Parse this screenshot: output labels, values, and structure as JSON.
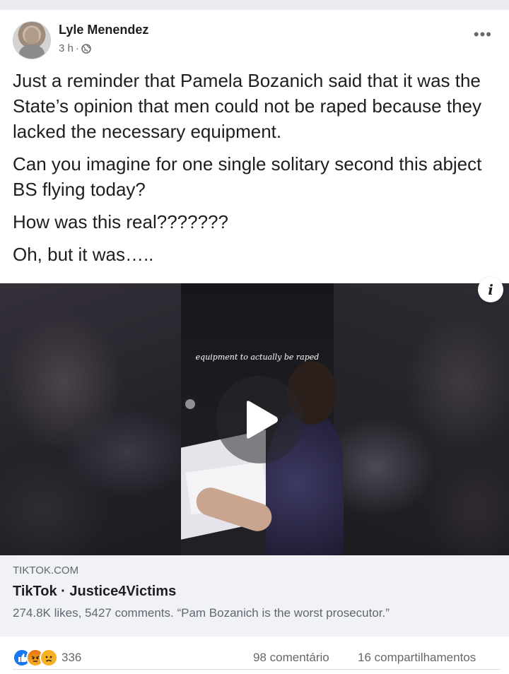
{
  "post": {
    "author": "Lyle Menendez",
    "time": "3 h",
    "separator": "·",
    "paragraphs": [
      "Just a reminder that Pamela Bozanich said that it was the State’s opinion that men could not be raped because they lacked the necessary equipment.",
      "Can you imagine for one single solitary second this abject BS flying today?",
      "How was this real???????",
      "Oh, but it was….."
    ]
  },
  "video": {
    "caption": "equipment to actually be raped"
  },
  "link_preview": {
    "domain": "TIKTOK.COM",
    "title": "TikTok · Justice4Victims",
    "description": "274.8K likes, 5427 comments. “Pam Bozanich is the worst prosecutor.”"
  },
  "footer": {
    "reaction_count": "336",
    "comments": "98 comentário",
    "shares": "16 compartilhamentos",
    "reaction_icons": [
      "like-icon",
      "angry-icon",
      "sad-icon"
    ]
  },
  "colors": {
    "like": "#1877f2",
    "secondary_text": "#65676b",
    "preview_bg": "#f0f2f5"
  }
}
